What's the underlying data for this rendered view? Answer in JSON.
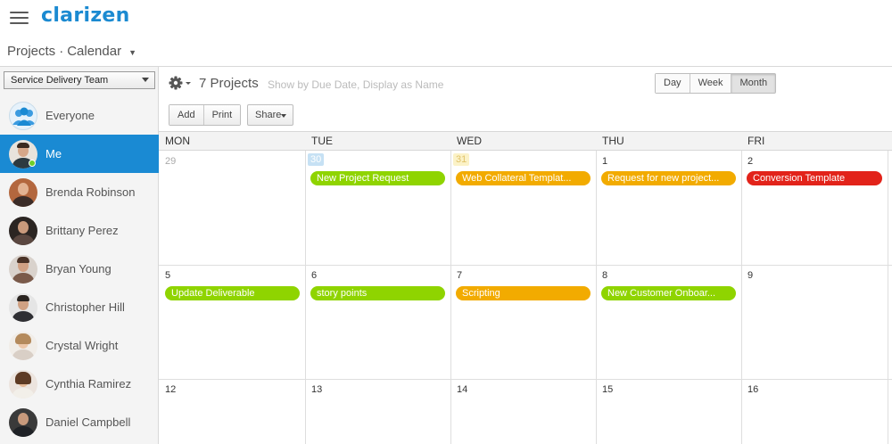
{
  "app": {
    "logo": "clarizen"
  },
  "breadcrumb": {
    "section": "Projects",
    "sep": "·",
    "view": "Calendar"
  },
  "sidebar": {
    "team_select": "Service Delivery Team",
    "people": [
      {
        "name": "Everyone",
        "type": "group"
      },
      {
        "name": "Me",
        "active": true
      },
      {
        "name": "Brenda Robinson"
      },
      {
        "name": "Brittany Perez"
      },
      {
        "name": "Bryan Young"
      },
      {
        "name": "Christopher Hill"
      },
      {
        "name": "Crystal Wright"
      },
      {
        "name": "Cynthia Ramirez"
      },
      {
        "name": "Daniel Campbell"
      }
    ]
  },
  "toolbar": {
    "projects_count": "7 Projects",
    "filter_info": "Show by Due Date, Display as Name",
    "views": [
      "Day",
      "Week",
      "Month"
    ],
    "selected_view": "Month",
    "add_label": "Add",
    "print_label": "Print",
    "share_label": "Share"
  },
  "calendar": {
    "day_names": [
      "MON",
      "TUE",
      "WED",
      "THU",
      "FRI"
    ],
    "weeks": [
      [
        "29",
        "30",
        "31",
        "1",
        "2"
      ],
      [
        "5",
        "6",
        "7",
        "8",
        "9"
      ],
      [
        "12",
        "13",
        "14",
        "15",
        "16"
      ]
    ],
    "events": [
      {
        "label": "New Project Request",
        "week": 0,
        "day": 1,
        "color": "#8fd400"
      },
      {
        "label": "Web Collateral Templat...",
        "week": 0,
        "day": 2,
        "color": "#f2ab00"
      },
      {
        "label": "Request for new project...",
        "week": 0,
        "day": 3,
        "color": "#f2ab00"
      },
      {
        "label": "Conversion Template",
        "week": 0,
        "day": 4,
        "color": "#e2231a"
      },
      {
        "label": "Update Deliverable",
        "week": 1,
        "day": 0,
        "color": "#8fd400"
      },
      {
        "label": "story points",
        "week": 1,
        "day": 1,
        "color": "#8fd400"
      },
      {
        "label": "Scripting",
        "week": 1,
        "day": 2,
        "color": "#f2ab00"
      },
      {
        "label": "New Customer Onboar...",
        "week": 1,
        "day": 3,
        "color": "#8fd400"
      }
    ]
  },
  "colors": {
    "accent": "#1a8ad3",
    "green": "#8fd400",
    "orange": "#f2ab00",
    "red": "#e2231a"
  }
}
